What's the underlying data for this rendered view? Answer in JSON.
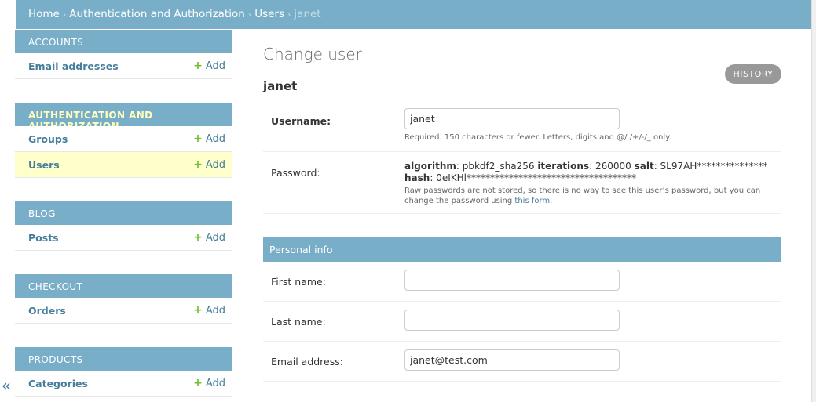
{
  "breadcrumbs": {
    "home": "Home",
    "section": "Authentication and Authorization",
    "model": "Users",
    "current": "janet",
    "separator": "›"
  },
  "sidebar": {
    "add_label": "Add",
    "add_icon": "plus-icon",
    "collapse_glyph": "«",
    "modules": [
      {
        "title": "Accounts",
        "models": [
          {
            "name": "Email addresses"
          }
        ]
      },
      {
        "title": "Authentication and Authorization",
        "models": [
          {
            "name": "Groups"
          },
          {
            "name": "Users"
          }
        ]
      },
      {
        "title": "Blog",
        "models": [
          {
            "name": "Posts"
          }
        ]
      },
      {
        "title": "Checkout",
        "models": [
          {
            "name": "Orders"
          }
        ]
      },
      {
        "title": "Products",
        "models": [
          {
            "name": "Categories"
          }
        ]
      }
    ]
  },
  "main": {
    "title": "Change user",
    "history_button": "HISTORY",
    "object_name": "janet",
    "username": {
      "label": "Username:",
      "value": "janet",
      "help": "Required. 150 characters or fewer. Letters, digits and @/./+/-/_ only."
    },
    "password": {
      "label": "Password:",
      "algorithm_key": "algorithm",
      "algorithm_value": ": pbkdf2_sha256 ",
      "iterations_key": "iterations",
      "iterations_value": ": 260000 ",
      "salt_key": "salt",
      "salt_value": ": SL97AH*************** ",
      "hash_key": "hash",
      "hash_value": ": 0eIKHl************************************",
      "help_prefix": "Raw passwords are not stored, so there is no way to see this user’s password, but you can change the password using ",
      "help_link": "this form",
      "help_suffix": "."
    },
    "personal_info": {
      "header": "Personal info",
      "first_name": {
        "label": "First name:",
        "value": ""
      },
      "last_name": {
        "label": "Last name:",
        "value": ""
      },
      "email": {
        "label": "Email address:",
        "value": "janet@test.com"
      }
    }
  },
  "colors": {
    "header_blue": "#79aec8",
    "link_blue": "#447e9b",
    "add_green": "#70bf2b",
    "selected_row": "#ffffcc",
    "active_module_text": "#ffffc0"
  }
}
